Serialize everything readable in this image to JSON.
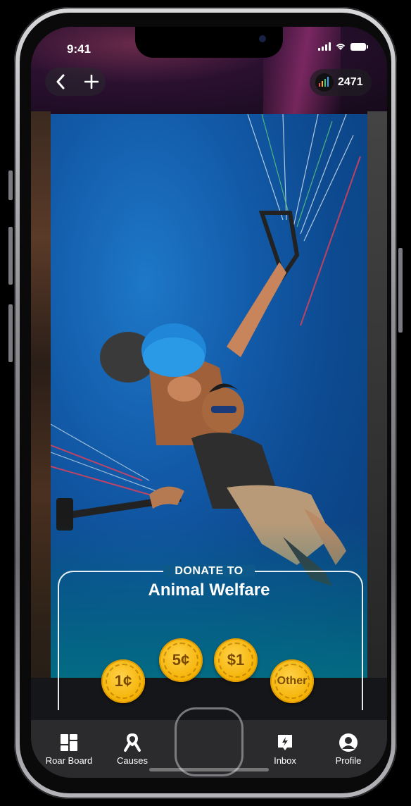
{
  "status_bar": {
    "time": "9:41"
  },
  "header": {
    "back_icon": "chevron-left-icon",
    "add_icon": "plus-icon",
    "score": "2471"
  },
  "donate": {
    "label": "DONATE TO",
    "cause": "Animal Welfare"
  },
  "coins": [
    {
      "label": "1¢"
    },
    {
      "label": "5¢"
    },
    {
      "label": "$1"
    },
    {
      "label": "Other"
    }
  ],
  "tabs": [
    {
      "label": "Roar Board",
      "icon": "grid-icon"
    },
    {
      "label": "Causes",
      "icon": "ribbon-icon"
    },
    {
      "label": "Inbox",
      "icon": "inbox-bolt-icon"
    },
    {
      "label": "Profile",
      "icon": "profile-icon"
    }
  ],
  "colors": {
    "coin": "#f4b000",
    "tabbar": "#2b2b2d"
  }
}
